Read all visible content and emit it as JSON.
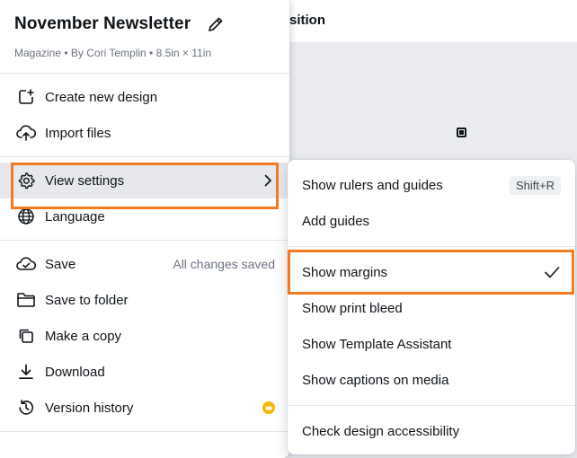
{
  "background": {
    "toolbar_text": "sition"
  },
  "header": {
    "title": "November Newsletter",
    "subtitle": "Magazine • By Cori Templin • 8.5in × 11in"
  },
  "main_menu": {
    "create_new_design": "Create new design",
    "import_files": "Import files",
    "view_settings": "View settings",
    "language": "Language",
    "save": "Save",
    "save_status": "All changes saved",
    "save_to_folder": "Save to folder",
    "make_a_copy": "Make a copy",
    "download": "Download",
    "version_history": "Version history"
  },
  "view_settings_menu": {
    "show_rulers": "Show rulers and guides",
    "show_rulers_shortcut": "Shift+R",
    "add_guides": "Add guides",
    "show_margins": "Show margins",
    "show_margins_checked": true,
    "show_print_bleed": "Show print bleed",
    "show_template_assistant": "Show Template Assistant",
    "show_captions": "Show captions on media",
    "check_accessibility": "Check design accessibility"
  },
  "colors": {
    "highlight": "#f47a20",
    "premium_crown": "#f5b700",
    "active_row": "#e6e8ec"
  }
}
